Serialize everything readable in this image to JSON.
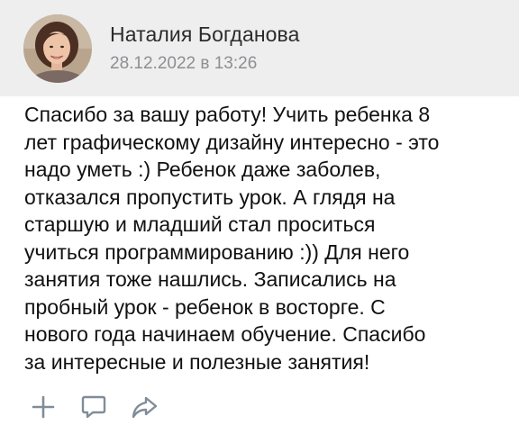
{
  "post": {
    "author_name": "Наталия Богданова",
    "timestamp": "28.12.2022 в 13:26",
    "text": "Спасибо за вашу работу! Учить ребенка 8\nлет графическому дизайну интересно - это\nнадо уметь :) Ребенок даже заболев,\nотказался пропустить урок. А глядя на\nстаршую и младший стал проситься\nучиться программированию :)) Для него\nзанятия тоже нашлись. Записались на\nпробный урок - ребенок в восторге. С\nнового года начинаем обучение. Спасибо\nза интересные и полезные занятия!"
  },
  "actions": [
    {
      "icon": "plus-icon"
    },
    {
      "icon": "comment-icon"
    },
    {
      "icon": "share-icon"
    }
  ],
  "colors": {
    "header_bg": "#eeeeee",
    "author": "#2b2b2b",
    "date": "#8e8e93",
    "text": "#111111",
    "icon": "#818c99"
  }
}
